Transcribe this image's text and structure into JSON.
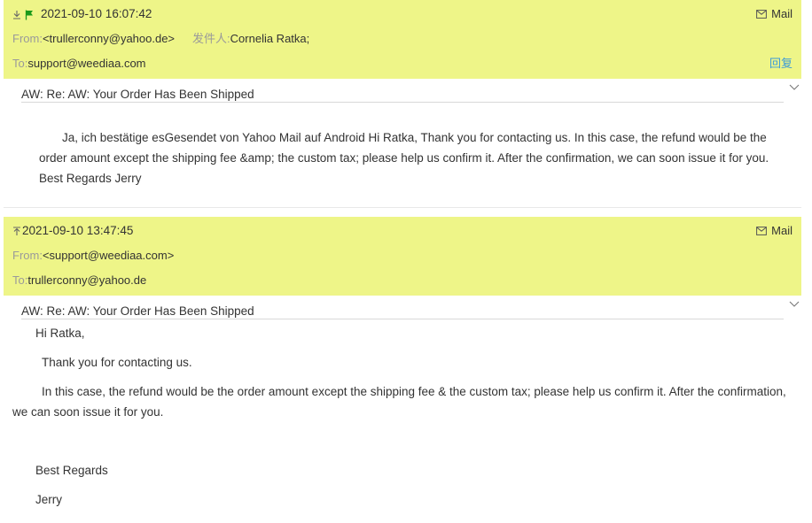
{
  "messages": [
    {
      "direction_icon": "download-arrow-icon",
      "flag_icon": "green-flag-icon",
      "date": "2021-09-10 16:07:42",
      "mail_tag": "Mail",
      "from_label": "From:",
      "from_value": "<trullerconny@yahoo.de>",
      "sender_label": "发件人:",
      "sender_value": "Cornelia Ratka;",
      "to_label": "To:",
      "to_value": "support@weediaa.com",
      "reply_label": "回复",
      "subject": "AW: Re: AW: Your Order Has Been Shipped",
      "body": "Ja, ich bestätige esGesendet von Yahoo Mail auf Android Hi Ratka,   Thank you for contacting us.   In this case, the refund would be the order amount except the shipping fee &amp; the custom tax; please help us confirm it. After the confirmation, we can soon issue it for you.   Best Regards Jerry"
    },
    {
      "direction_icon": "upload-arrow-icon",
      "date": "2021-09-10 13:47:45",
      "mail_tag": "Mail",
      "from_label": "From:",
      "from_value": "<support@weediaa.com>",
      "to_label": "To:",
      "to_value": "trullerconny@yahoo.de",
      "subject": "AW: Re: AW: Your Order Has Been Shipped",
      "body_lines": {
        "greeting": "Hi Ratka,",
        "thanks": "Thank you for contacting us.",
        "refund": "In this case, the refund would be the order amount except the shipping fee & the custom tax; please help us confirm it. After the confirmation, we can soon issue it for you.",
        "regards": "Best Regards",
        "signature": "Jerry"
      }
    }
  ],
  "colors": {
    "header_bg": "#eef588",
    "label": "#9a9a9a",
    "reply_link": "#3b9ad9",
    "flag": "#1a9a1a"
  }
}
